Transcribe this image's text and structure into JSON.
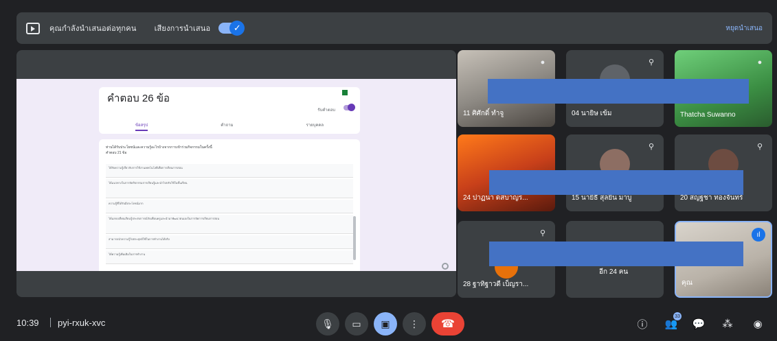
{
  "banner": {
    "presenting_text": "คุณกำลังนำเสนอต่อทุกคน",
    "audio_text": "เสียงการนำเสนอ",
    "stop_label": "หยุดนำเสนอ",
    "toggle_on": true
  },
  "form": {
    "title": "คำตอบ 26 ข้อ",
    "accepting_label": "รับคำตอบ",
    "tabs": [
      "ข้อสรุป",
      "คำถาม",
      "รายบุคคล"
    ],
    "question_text": "ท่านได้รับประโยชน์และความรู้อะไรบ้างจากการเข้าร่วมกิจกรรมในครั้งนี้",
    "response_count": "คำตอบ 21 ข้อ",
    "responses": [
      "ได้รับความรู้เกี่ยวกับการใช้งานเทคโนโลยีเพื่อการเรียนการสอน",
      "ได้แนวทางในการจัดกิจกรรมการเรียนรู้และนำไปปรับใช้ในชั้นเรียน",
      "ความรู้ที่ได้รับมีประโยชน์มาก",
      "ได้แลกเปลี่ยนเรียนรู้ประสบการณ์กับเพื่อนครูและนำมาพัฒนาตนเองในการจัดการเรียนการสอน",
      "สามารถนำความรู้ไปประยุกต์ใช้ในการทำงานได้จริง",
      "ได้ความรู้เพิ่มเติมในการทำงาน"
    ]
  },
  "participants": [
    {
      "name": "11 ศิศักดิ์ ทำจู",
      "muted": false
    },
    {
      "name": "04 นายิษ เข้ม",
      "muted": true
    },
    {
      "name": "Thatcha Suwanno",
      "muted": false
    },
    {
      "name": "24 ปาฏนา ดสบาญร...",
      "muted": false
    },
    {
      "name": "15 นายิธี สุลยิน มาบู",
      "muted": true
    },
    {
      "name": "20 สญฐชา ทองจันทร์",
      "muted": true
    },
    {
      "name": "28 ฐาทิฐาวดี เบ็ญรา...",
      "muted": true
    },
    {
      "name": "อีก 24 คน",
      "muted": false
    },
    {
      "name": "คุณ",
      "muted": false
    }
  ],
  "toolbar": {
    "time": "10:39",
    "meeting_code": "pyi-rxuk-xvc",
    "people_count": "33"
  },
  "icons": {
    "mic": "mic-icon",
    "camera": "camera-icon",
    "present": "present-icon",
    "more": "more-icon",
    "end": "end-call-icon"
  }
}
